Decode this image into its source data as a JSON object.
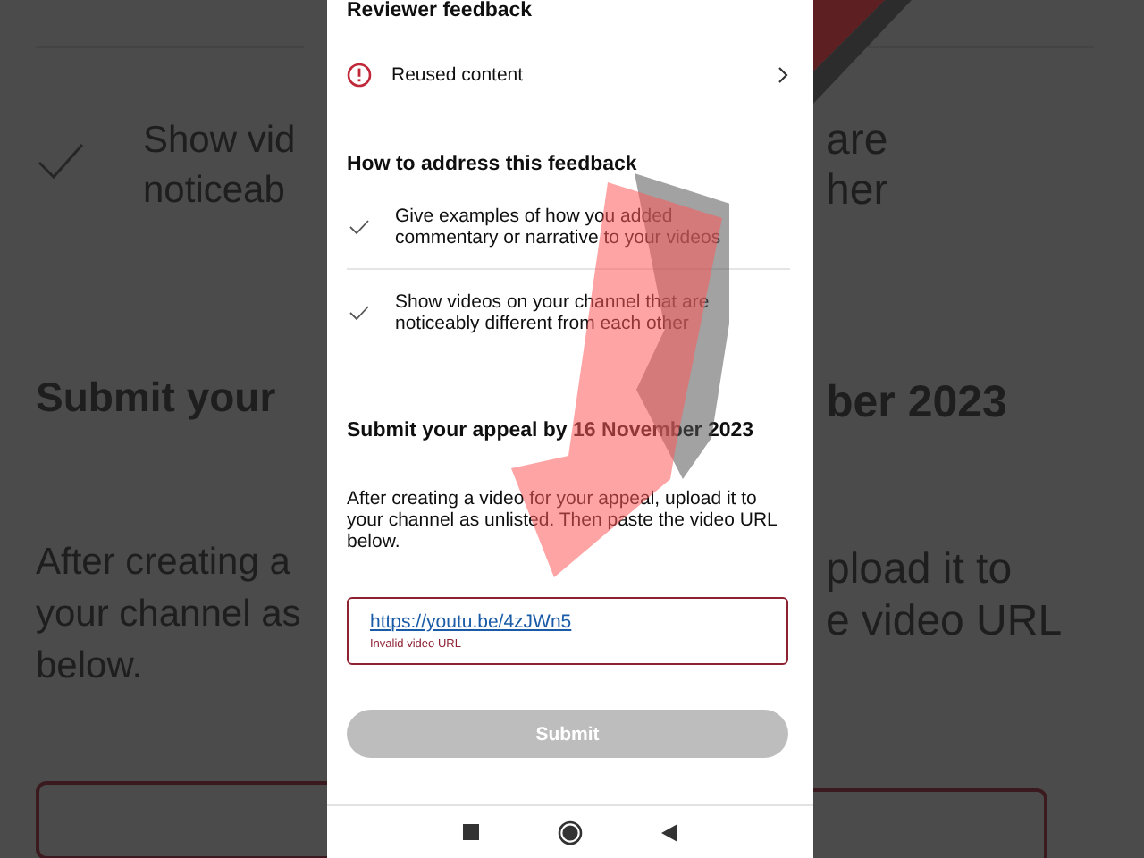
{
  "backdrop": {
    "left": {
      "check_lines": [
        "Show vid",
        "noticeab"
      ],
      "heading": "Submit your",
      "paragraph_lines": [
        "After creating a",
        "your channel as",
        "below."
      ]
    },
    "right": {
      "check_lines": [
        "are",
        "her"
      ],
      "heading": "ber 2023",
      "paragraph_lines": [
        "pload it to",
        "e video URL"
      ]
    }
  },
  "phone": {
    "section_title": "Reviewer feedback",
    "reason": {
      "label": "Reused content"
    },
    "address_title": "How to address this feedback",
    "tips": [
      {
        "text": "Give examples of how you added commentary or narrative to your videos",
        "done": true
      },
      {
        "text": "Show videos on your channel that are noticeably different from each other",
        "done": true
      }
    ],
    "appeal_title": "Submit your appeal by 16 November 2023",
    "instructions": "After creating a video for your appeal, upload it to your channel as unlisted. Then paste the video URL below.",
    "url_field": {
      "value": "https://youtu.be/4zJWn5",
      "error": "Invalid video URL",
      "invalid": true
    },
    "submit": {
      "label": "Submit",
      "disabled": true
    }
  }
}
